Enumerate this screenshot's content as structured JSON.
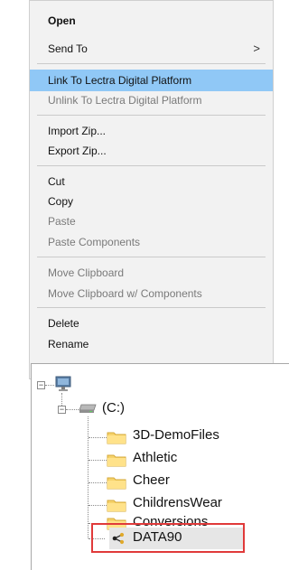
{
  "context_menu": {
    "items": [
      {
        "label": "Open"
      },
      {
        "label": "Send To"
      },
      {
        "label": "Link To Lectra Digital Platform"
      },
      {
        "label": "Unlink To Lectra Digital Platform"
      },
      {
        "label": "Import Zip..."
      },
      {
        "label": "Export Zip..."
      },
      {
        "label": "Cut"
      },
      {
        "label": "Copy"
      },
      {
        "label": "Paste"
      },
      {
        "label": "Paste Components"
      },
      {
        "label": "Move Clipboard"
      },
      {
        "label": "Move Clipboard w/ Components"
      },
      {
        "label": "Delete"
      },
      {
        "label": "Rename"
      }
    ],
    "submenu_arrow": ">"
  },
  "tree": {
    "root": {
      "icon": "computer-icon"
    },
    "drive": {
      "label": "(C:)",
      "icon": "drive-icon"
    },
    "folders": [
      {
        "label": "3D-DemoFiles",
        "icon": "folder-icon"
      },
      {
        "label": "Athletic",
        "icon": "folder-icon"
      },
      {
        "label": "Cheer",
        "icon": "folder-icon"
      },
      {
        "label": "ChildrensWear",
        "icon": "folder-icon"
      },
      {
        "label": "Conversions",
        "icon": "folder-icon"
      },
      {
        "label": "DATA90",
        "icon": "share-icon"
      }
    ],
    "highlight_color": "#e03a3a"
  }
}
